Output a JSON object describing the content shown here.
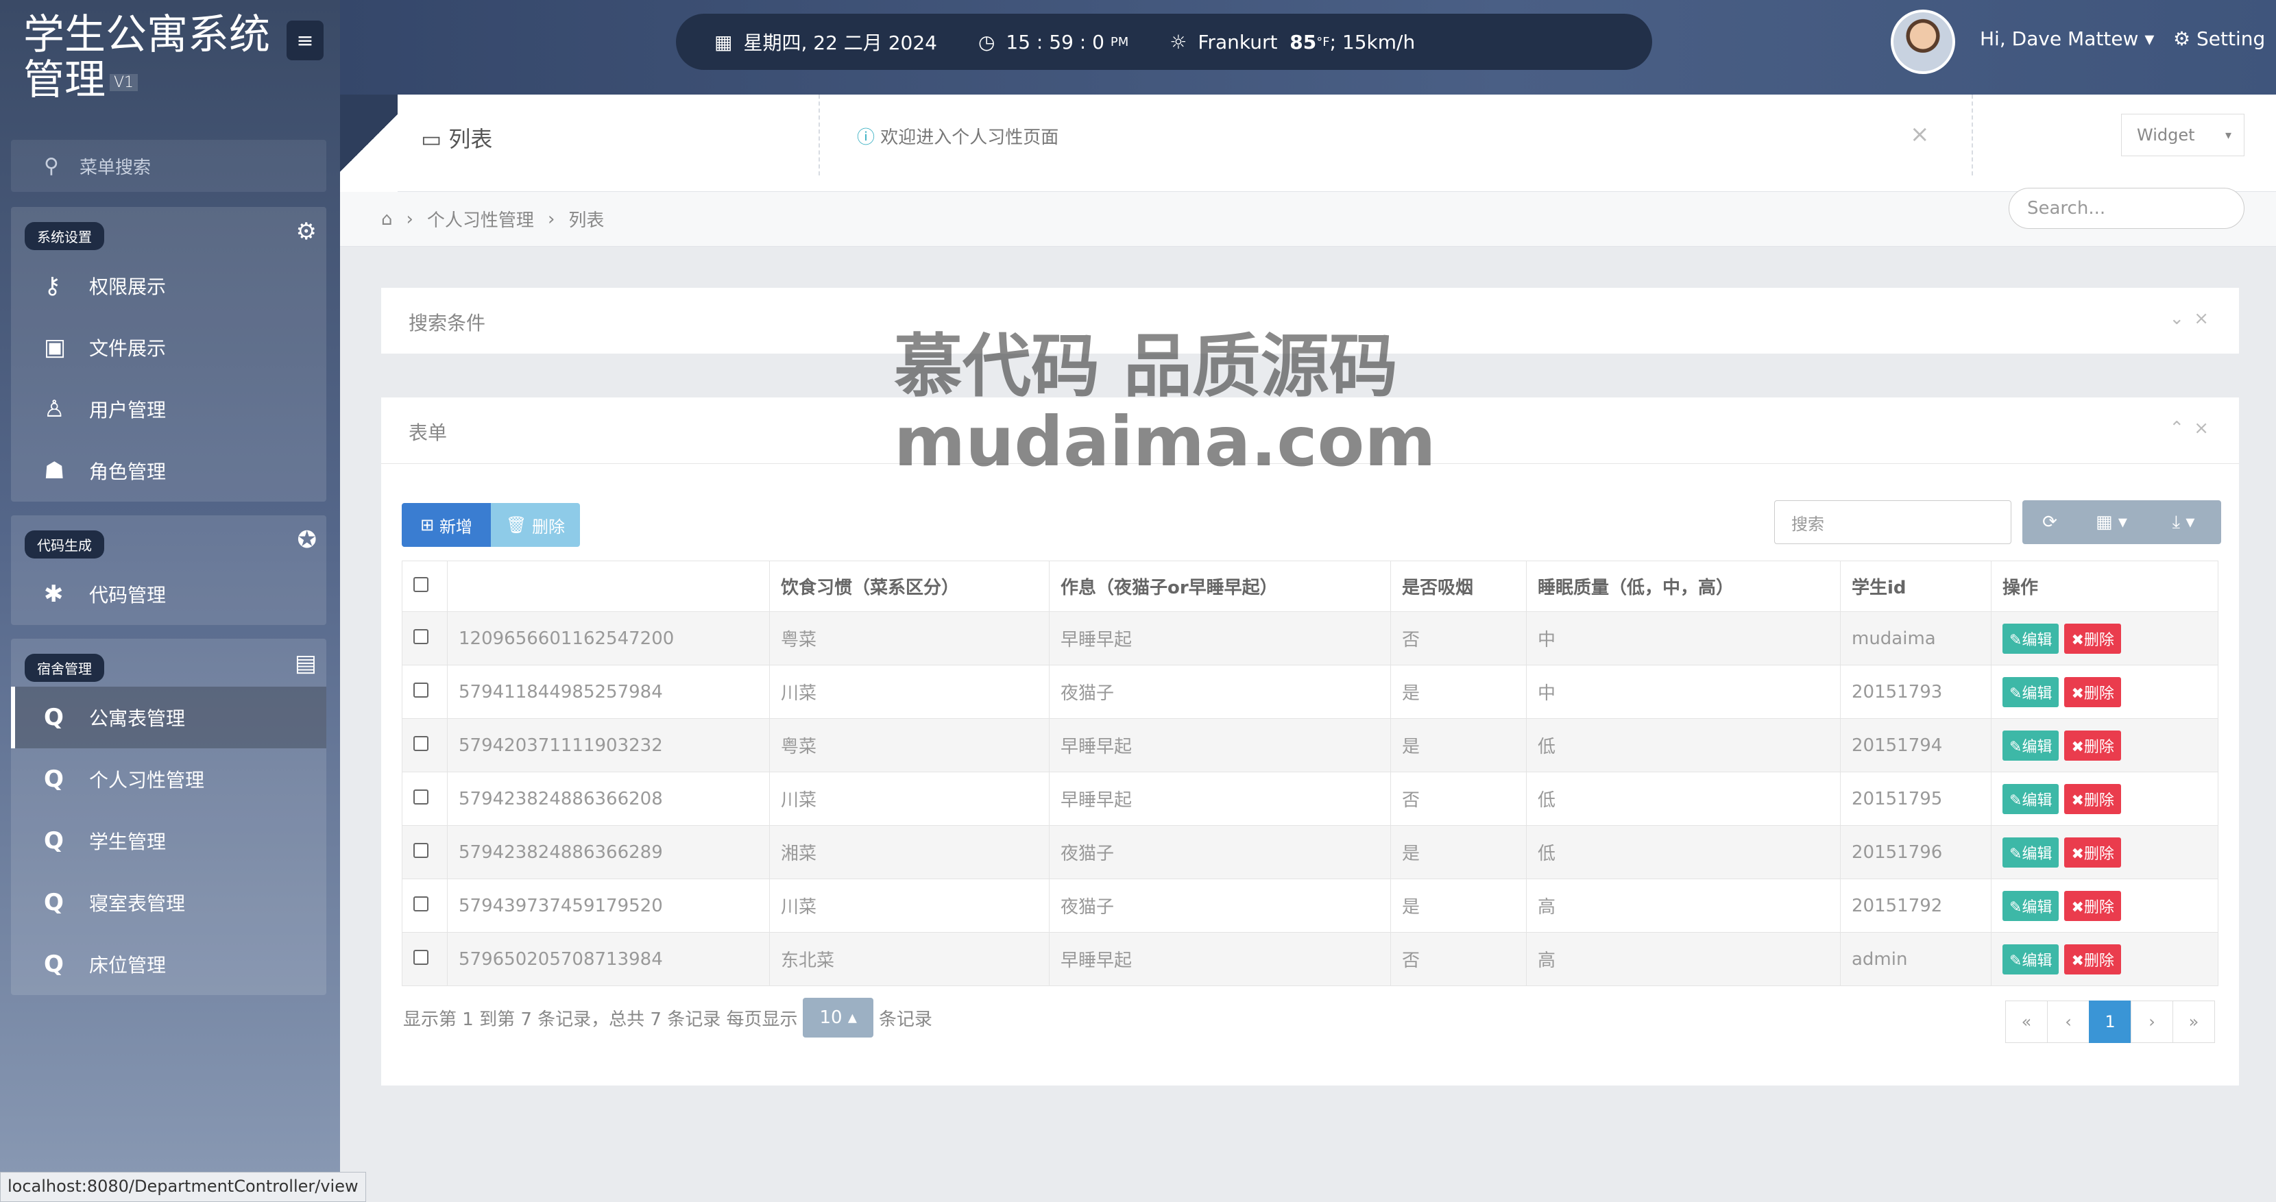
{
  "app": {
    "title": "学生公寓系统管理",
    "version": "V1"
  },
  "sidebar": {
    "search_label": "菜单搜索",
    "groups": [
      {
        "tag": "系统设置",
        "icon": "gear-icon",
        "items": [
          {
            "label": "权限展示",
            "icon": "key-icon"
          },
          {
            "label": "文件展示",
            "icon": "image-icon"
          },
          {
            "label": "用户管理",
            "icon": "user-icon"
          },
          {
            "label": "角色管理",
            "icon": "users-icon"
          }
        ]
      },
      {
        "tag": "代码生成",
        "icon": "rebel-icon",
        "items": [
          {
            "label": "代码管理",
            "icon": "bug-icon"
          }
        ]
      },
      {
        "tag": "宿舍管理",
        "icon": "contact-card-icon",
        "items": [
          {
            "label": "公寓表管理",
            "icon": "q-icon",
            "active": true
          },
          {
            "label": "个人习性管理",
            "icon": "q-icon"
          },
          {
            "label": "学生管理",
            "icon": "q-icon"
          },
          {
            "label": "寝室表管理",
            "icon": "q-icon"
          },
          {
            "label": "床位管理",
            "icon": "q-icon"
          }
        ]
      }
    ]
  },
  "topbar": {
    "date": "星期四, 22 二月 2024",
    "time": "15 : 59 : 0",
    "ampm": "PM",
    "city": "Frankurt",
    "temp": "85",
    "temp_unit": "°F",
    "wind": "; 15km/h",
    "greeting": "Hi, Dave Mattew",
    "setting": "Setting"
  },
  "pagehead": {
    "title": "列表",
    "message": "欢迎进入个人习性页面",
    "close": "×",
    "widget": "Widget"
  },
  "breadcrumb": {
    "items": [
      "个人习性管理",
      "列表"
    ]
  },
  "search_placeholder": "Search...",
  "search_panel": {
    "title": "搜索条件"
  },
  "table_panel": {
    "title": "表单",
    "add": "新增",
    "delete": "删除",
    "search_placeholder": "搜索",
    "columns": [
      "",
      "饮食习惯（菜系区分）",
      "作息（夜猫子or早睡早起）",
      "是否吸烟",
      "睡眠质量（低，中，高）",
      "学生id",
      "操作"
    ],
    "rows": [
      [
        "1209656601162547200",
        "粤菜",
        "早睡早起",
        "否",
        "中",
        "mudaima"
      ],
      [
        "579411844985257984",
        "川菜",
        "夜猫子",
        "是",
        "中",
        "20151793"
      ],
      [
        "579420371111903232",
        "粤菜",
        "早睡早起",
        "是",
        "低",
        "20151794"
      ],
      [
        "579423824886366208",
        "川菜",
        "早睡早起",
        "否",
        "低",
        "20151795"
      ],
      [
        "579423824886366289",
        "湘菜",
        "夜猫子",
        "是",
        "低",
        "20151796"
      ],
      [
        "579439737459179520",
        "川菜",
        "夜猫子",
        "是",
        "高",
        "20151792"
      ],
      [
        "579650205708713984",
        "东北菜",
        "早睡早起",
        "否",
        "高",
        "admin"
      ]
    ],
    "edit_label": "编辑",
    "del_label": "删除",
    "page_info_prefix": "显示第 1 到第 7 条记录，总共 7 条记录 每页显示",
    "page_size": "10",
    "page_info_suffix": "条记录",
    "pager": [
      "«",
      "‹",
      "1",
      "›",
      "»"
    ]
  },
  "watermark": {
    "line1": "慕代码 品质源码",
    "line2": "mudaima.com"
  },
  "statusbar": "localhost:8080/DepartmentController/view"
}
